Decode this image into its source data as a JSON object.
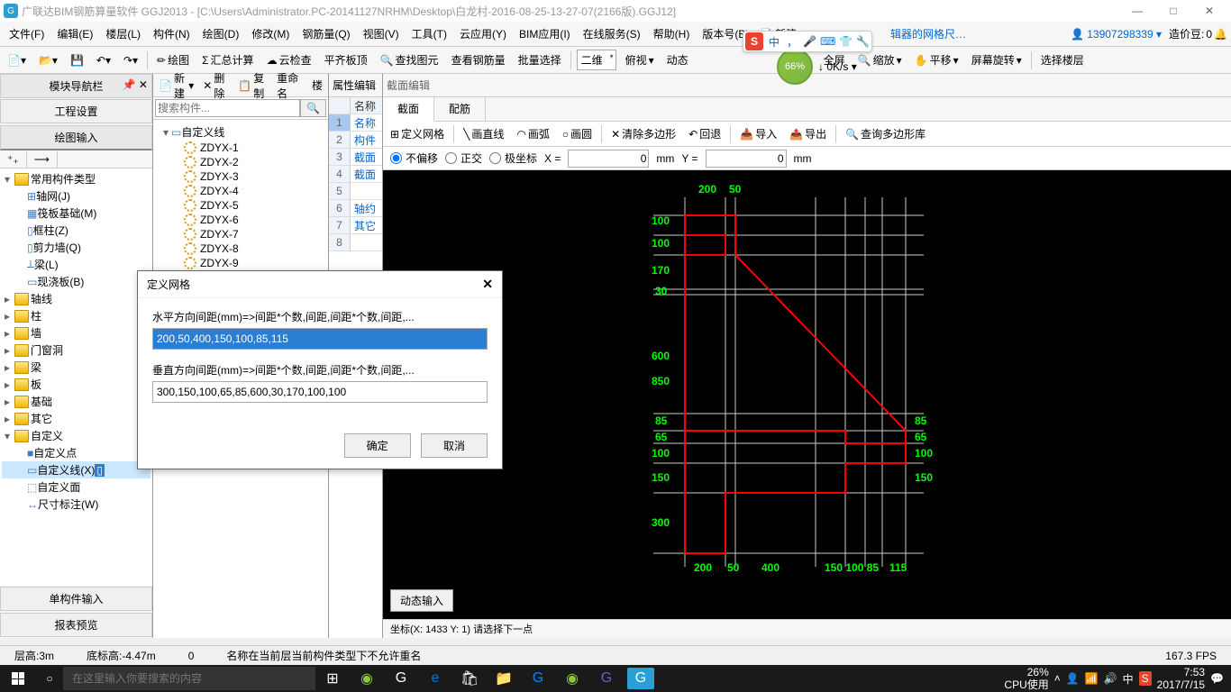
{
  "titlebar": {
    "text": "广联达BIM钢筋算量软件 GGJ2013 - [C:\\Users\\Administrator.PC-20141127NRHM\\Desktop\\白龙村-2016-08-25-13-27-07(2166版).GGJ12]"
  },
  "menubar": {
    "items": [
      "文件(F)",
      "编辑(E)",
      "楼层(L)",
      "构件(N)",
      "绘图(D)",
      "修改(M)",
      "钢筋量(Q)",
      "视图(V)",
      "工具(T)",
      "云应用(Y)",
      "BIM应用(I)",
      "在线服务(S)",
      "帮助(H)",
      "版本号(B)"
    ],
    "new_btn": "新建",
    "link_tip": "辑器的网格尺…",
    "user_id": "13907298339",
    "beans_label": "造价豆:",
    "beans_value": "0"
  },
  "ime": {
    "char": "中",
    "extra": "，"
  },
  "speed": {
    "pct": "66%",
    "rate": "0K/s"
  },
  "toolbar1": {
    "draw": "绘图",
    "sum": "汇总计算",
    "cloud": "云检查",
    "flat": "平齐板顶",
    "find": "查找图元",
    "rebar": "查看钢筋量",
    "batch": "批量选择"
  },
  "toolbar2": {
    "dim_combo": "二维",
    "view": "俯视",
    "dyn": "动态",
    "full": "全屏",
    "zoom": "缩放",
    "pan": "平移",
    "rot": "屏幕旋转",
    "sel_floor": "选择楼层"
  },
  "nav": {
    "title": "模块导航栏",
    "project_btn": "工程设置",
    "draw_btn": "绘图输入",
    "tree": {
      "common": "常用构件类型",
      "items": [
        "轴网(J)",
        "筏板基础(M)",
        "框柱(Z)",
        "剪力墙(Q)",
        "梁(L)",
        "现浇板(B)"
      ],
      "folders": [
        "轴线",
        "柱",
        "墙",
        "门窗洞",
        "梁",
        "板",
        "基础",
        "其它"
      ],
      "custom": "自定义",
      "custom_items": [
        "自定义点",
        "自定义线(X)",
        "自定义面",
        "尺寸标注(W)"
      ]
    },
    "single_input": "单构件输入",
    "report": "报表预览"
  },
  "comp": {
    "tb": {
      "new": "新建",
      "del": "删除",
      "copy": "复制",
      "rename": "重命名",
      "floor": "楼"
    },
    "search_ph": "搜索构件...",
    "root": "自定义线",
    "items": [
      "ZDYX-1",
      "ZDYX-2",
      "ZDYX-3",
      "ZDYX-4",
      "ZDYX-5",
      "ZDYX-6",
      "ZDYX-7",
      "ZDYX-8",
      "ZDYX-9"
    ]
  },
  "prop": {
    "title": "属性编辑",
    "header": "名称",
    "rows": [
      "名称",
      "构件",
      "截面",
      "截面",
      "轴约",
      "其它",
      "…"
    ]
  },
  "canvas": {
    "title": "截面编辑",
    "tabs": [
      "截面",
      "配筋"
    ],
    "tb": {
      "grid": "定义网格",
      "line": "画直线",
      "arc": "画弧",
      "circle": "画圆",
      "clear": "清除多边形",
      "undo": "回退",
      "imp": "导入",
      "exp": "导出",
      "query": "查询多边形库"
    },
    "coords": {
      "r1": "不偏移",
      "r2": "正交",
      "r3": "极坐标",
      "xl": "X =",
      "yl": "Y =",
      "xv": "0",
      "yv": "0",
      "unit": "mm"
    },
    "dyn_btn": "动态输入",
    "hint": "坐标(X: 1433 Y: 1) 请选择下一点",
    "dims_top": [
      "200",
      "50"
    ],
    "dims_left": [
      "100",
      "100",
      "170",
      "30",
      "600",
      "850",
      "85",
      "65",
      "100",
      "150",
      "300"
    ],
    "dims_right": [
      "85",
      "65",
      "100",
      "150"
    ],
    "dims_bottom": [
      "200",
      "50",
      "400",
      "150 100 85",
      "115"
    ]
  },
  "dialog": {
    "title": "定义网格",
    "h_label": "水平方向间距(mm)=>间距*个数,间距,间距*个数,间距,...",
    "h_value": "200,50,400,150,100,85,115",
    "v_label": "垂直方向间距(mm)=>间距*个数,间距,间距*个数,间距,...",
    "v_value": "300,150,100,65,85,600,30,170,100,100",
    "ok": "确定",
    "cancel": "取消"
  },
  "status": {
    "floor_h": "层高:3m",
    "bot_h": "底标高:-4.47m",
    "zero": "0",
    "msg": "名称在当前层当前构件类型下不允许重名",
    "fps": "167.3 FPS"
  },
  "taskbar": {
    "search_ph": "在这里输入你要搜索的内容",
    "cpu_pct": "26%",
    "cpu_lbl": "CPU使用",
    "ime": "中",
    "time": "7:53",
    "date": "2017/7/15"
  }
}
